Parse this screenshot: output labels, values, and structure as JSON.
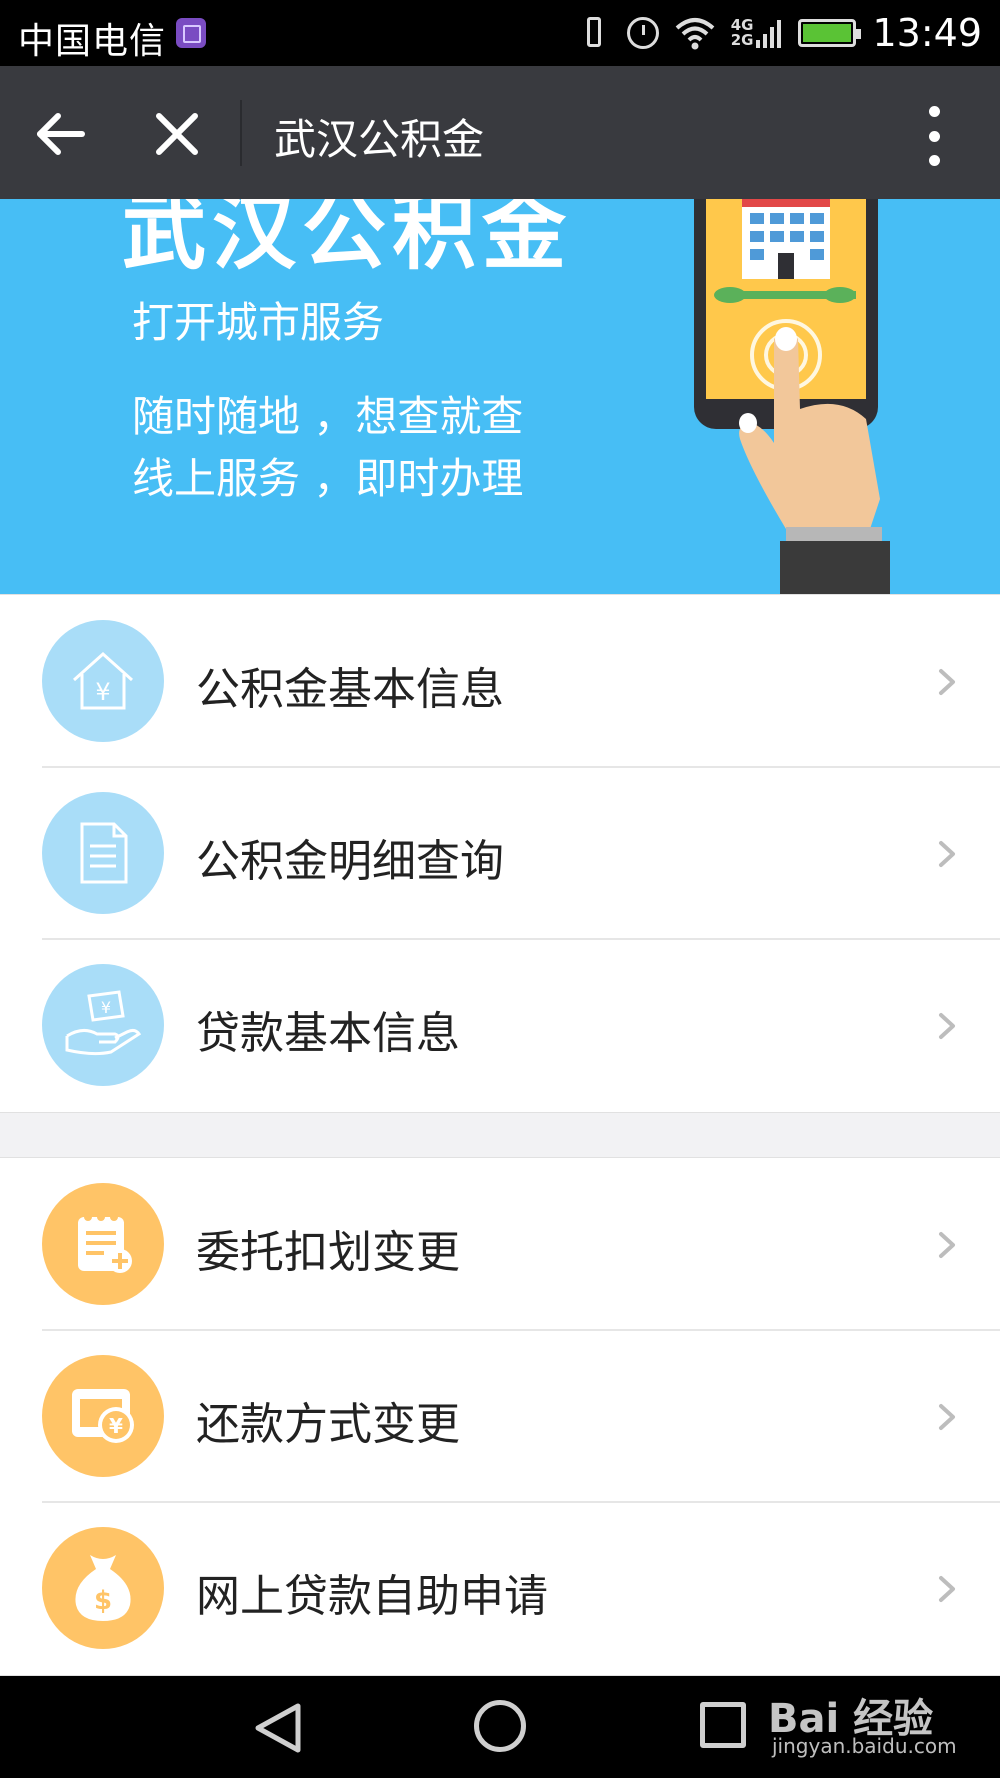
{
  "status_bar": {
    "carrier": "中国电信",
    "network": "4G\n2G",
    "time": "13:49"
  },
  "header": {
    "title": "武汉公积金"
  },
  "banner": {
    "headline": "武汉公积金",
    "subtitle": "打开城市服务",
    "line1": "随时随地 ，想查就查",
    "line2": "线上服务 ，即时办理"
  },
  "colors": {
    "blue_icon_bg": "#a9ddf8",
    "orange_icon_bg": "#ffc467",
    "banner_bg": "#47bef5",
    "title_bar_bg": "#393a3f"
  },
  "groups": [
    {
      "items": [
        {
          "label": "公积金基本信息",
          "icon": "house-yuan-icon"
        },
        {
          "label": "公积金明细查询",
          "icon": "document-icon"
        },
        {
          "label": "贷款基本信息",
          "icon": "hand-money-icon"
        }
      ]
    },
    {
      "items": [
        {
          "label": "委托扣划变更",
          "icon": "clipboard-add-icon"
        },
        {
          "label": "还款方式变更",
          "icon": "wallet-yuan-icon"
        },
        {
          "label": "网上贷款自助申请",
          "icon": "money-bag-icon"
        }
      ]
    }
  ],
  "watermark": {
    "logo": "Bai 经验",
    "url": "jingyan.baidu.com"
  }
}
